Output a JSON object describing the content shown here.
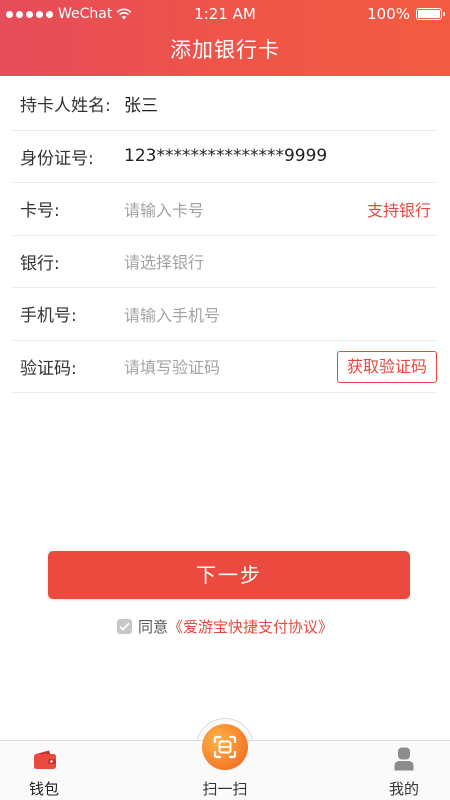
{
  "status_bar": {
    "carrier": "WeChat",
    "time": "1:21 AM",
    "battery": "100%"
  },
  "nav": {
    "title": "添加银行卡"
  },
  "form": {
    "holder_name": {
      "label": "持卡人姓名:",
      "value": "张三"
    },
    "id_number": {
      "label": "身份证号:",
      "value": "123***************9999"
    },
    "card_number": {
      "label": "卡号:",
      "placeholder": "请输入卡号",
      "link": "支持银行"
    },
    "bank": {
      "label": "银行:",
      "placeholder": "请选择银行"
    },
    "phone": {
      "label": "手机号:",
      "placeholder": "请输入手机号"
    },
    "code": {
      "label": "验证码:",
      "placeholder": "请填写验证码",
      "button": "获取验证码"
    }
  },
  "actions": {
    "next": "下一步",
    "agree_prefix": "同意",
    "agree_link": "《爱游宝快捷支付协议》"
  },
  "tabbar": {
    "wallet": "钱包",
    "scan": "扫一扫",
    "me": "我的"
  },
  "colors": {
    "accent": "#e9473d",
    "header_start": "#e64c5a",
    "header_end": "#f25b42",
    "scan_orange": "#f7862e"
  },
  "icons": [
    "wallet-icon",
    "scan-icon",
    "profile-icon",
    "wifi-icon",
    "battery-icon",
    "checkbox-checked-icon"
  ]
}
